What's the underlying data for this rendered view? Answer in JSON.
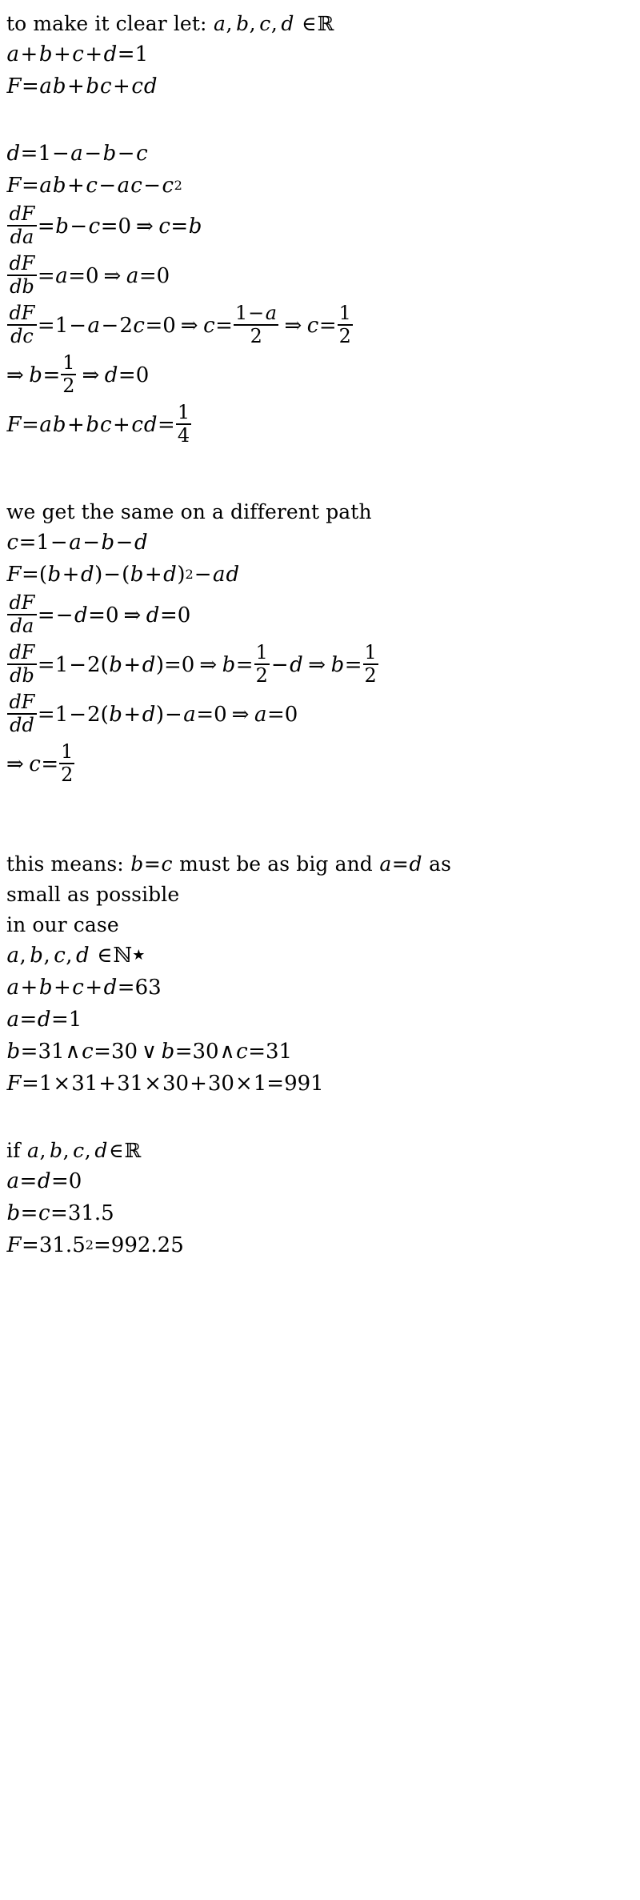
{
  "document": {
    "kind": "handwritten-style math derivation",
    "background_color": "#ffffff",
    "text_color": "#000000"
  },
  "blocks": [
    {
      "id": "intro",
      "lines": [
        {
          "id": "l1",
          "kind": "prose",
          "text": "to make it clear let: a, b, c, d ∈ℝ"
        },
        {
          "id": "l2",
          "kind": "math",
          "text": "a+b+c+d=1"
        },
        {
          "id": "l3",
          "kind": "math",
          "text": "F=ab+bc+cd"
        }
      ]
    },
    {
      "id": "path-one",
      "lines": [
        {
          "id": "l4",
          "kind": "math",
          "text": "d=1−a−b−c"
        },
        {
          "id": "l5",
          "kind": "math",
          "text": "F=ab+c−ac−c²"
        },
        {
          "id": "l6",
          "kind": "math",
          "text": "dF/da=b−c=0 ⇒ c=b"
        },
        {
          "id": "l7",
          "kind": "math",
          "text": "dF/db=a=0 ⇒ a=0"
        },
        {
          "id": "l8",
          "kind": "math",
          "text": "dF/dc=1−a−2c=0 ⇒ c=(1−a)/2 ⇒ c=1/2"
        },
        {
          "id": "l9",
          "kind": "math",
          "text": "⇒ b=1/2 ⇒ d=0"
        },
        {
          "id": "l10",
          "kind": "math",
          "text": "F=ab+bc+cd=1/4"
        }
      ]
    },
    {
      "id": "path-two",
      "lines": [
        {
          "id": "l11",
          "kind": "prose",
          "text": "we get the same on a different path"
        },
        {
          "id": "l12",
          "kind": "math",
          "text": "c=1−a−b−d"
        },
        {
          "id": "l13",
          "kind": "math",
          "text": "F=(b+d)−(b+d)²−ad"
        },
        {
          "id": "l14",
          "kind": "math",
          "text": "dF/da=−d=0 ⇒ d=0"
        },
        {
          "id": "l15",
          "kind": "math",
          "text": "dF/db=1−2(b+d)=0 ⇒ b=1/2−d ⇒ b=1/2"
        },
        {
          "id": "l16",
          "kind": "math",
          "text": "dF/dd=1−2(b+d)−a=0 ⇒ a=0"
        },
        {
          "id": "l17",
          "kind": "math",
          "text": "⇒ c=1/2"
        }
      ]
    },
    {
      "id": "conclusion",
      "lines": [
        {
          "id": "l18",
          "kind": "prose",
          "text": "this means: b=c must be as big and a=d as"
        },
        {
          "id": "l19",
          "kind": "prose",
          "text": "small as possible"
        },
        {
          "id": "l20",
          "kind": "prose",
          "text": "in our case"
        },
        {
          "id": "l21",
          "kind": "math",
          "text": "a, b, c, d ∈ℕ★"
        },
        {
          "id": "l22",
          "kind": "math",
          "text": "a+b+c+d=63"
        },
        {
          "id": "l23",
          "kind": "math",
          "text": "a=d=1"
        },
        {
          "id": "l24",
          "kind": "math",
          "text": "b=31∧c=30 ∨ b=30∧c=31"
        },
        {
          "id": "l25",
          "kind": "math",
          "text": "F=1×31+31×30+30×1=991"
        }
      ]
    },
    {
      "id": "real-case",
      "lines": [
        {
          "id": "l26",
          "kind": "prose",
          "text": "if a, b, c, d∈ℝ"
        },
        {
          "id": "l27",
          "kind": "math",
          "text": "a=d=0"
        },
        {
          "id": "l28",
          "kind": "math",
          "text": "b=c=31.5"
        },
        {
          "id": "l29",
          "kind": "math",
          "text": "F=31.5²=992.25"
        }
      ]
    }
  ],
  "tokens": {
    "prose": {
      "to_make_it_clear_let": "to make it clear let:",
      "we_get_same_path": "we get the same on a different path",
      "this_means": "this means:",
      "must_be_as_big_and": "must be as big and",
      "as": "as",
      "small_as_possible": "small as possible",
      "in_our_case": "in our case",
      "if": "if"
    },
    "vars": {
      "a": "a",
      "b": "b",
      "c": "c",
      "d": "d",
      "F": "F"
    },
    "ops": {
      "plus": "+",
      "minus": "−",
      "equals": "=",
      "times": "×",
      "implies": "⇒",
      "and": "∧",
      "or": "∨",
      "in": "∈",
      "comma": ",",
      "colon": ":",
      "lparen": "(",
      "rparen": ")",
      "reals": "ℝ",
      "naturals": "ℕ",
      "star": "★",
      "sup2": "2"
    },
    "numbers": {
      "zero": "0",
      "one": "1",
      "two": "2",
      "four": "4",
      "n30": "30",
      "n31": "31",
      "n63": "63",
      "n991": "991",
      "n992_25": "992.25",
      "n31_5": "31.5"
    },
    "diff": {
      "dF": "dF",
      "da": "da",
      "db": "db",
      "dc": "dc",
      "dd": "dd"
    }
  }
}
